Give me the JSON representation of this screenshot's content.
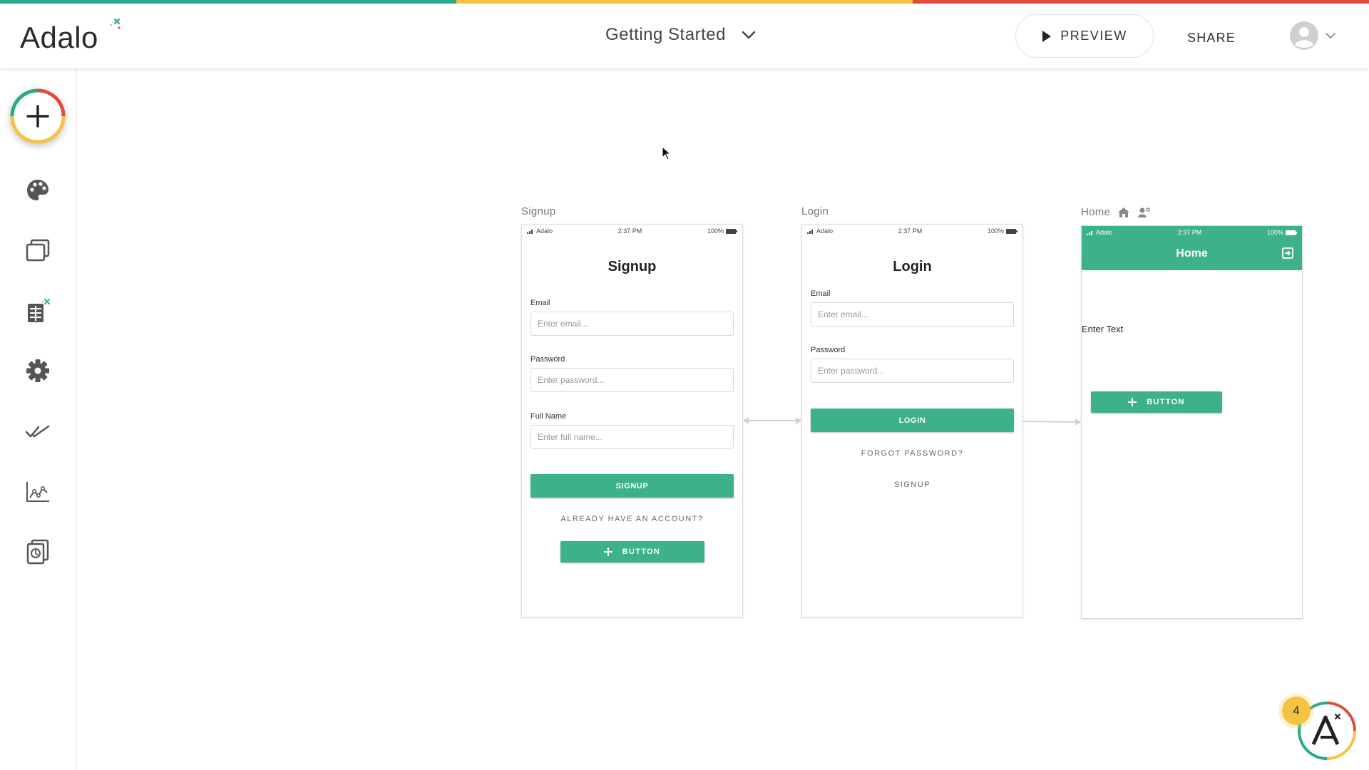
{
  "brand": {
    "name": "Adalo",
    "colors": {
      "green": "#3db08c",
      "yellow": "#f5c242",
      "red": "#e04b3c",
      "teal": "#27a98c"
    }
  },
  "header": {
    "app_name": "Getting Started",
    "preview_label": "PREVIEW",
    "share_label": "SHARE"
  },
  "sidebar": {
    "items": [
      {
        "icon": "plus-icon",
        "label": "Add"
      },
      {
        "icon": "palette-icon",
        "label": "Branding"
      },
      {
        "icon": "screens-icon",
        "label": "Screens"
      },
      {
        "icon": "database-icon",
        "label": "Database"
      },
      {
        "icon": "gear-icon",
        "label": "Settings"
      },
      {
        "icon": "publish-checkmark-icon",
        "label": "Publish"
      },
      {
        "icon": "analytics-icon",
        "label": "Analytics"
      },
      {
        "icon": "versions-icon",
        "label": "Versions"
      }
    ]
  },
  "screens": {
    "signup": {
      "label": "Signup",
      "status": {
        "carrier": "Adalo",
        "time": "2:37 PM",
        "battery": "100%"
      },
      "title": "Signup",
      "email_label": "Email",
      "email_placeholder": "Enter email...",
      "password_label": "Password",
      "password_placeholder": "Enter password...",
      "fullname_label": "Full Name",
      "fullname_placeholder": "Enter full name...",
      "submit_label": "SIGNUP",
      "link_label": "ALREADY HAVE AN ACCOUNT?",
      "button_label": "BUTTON"
    },
    "login": {
      "label": "Login",
      "status": {
        "carrier": "Adalo",
        "time": "2:37 PM",
        "battery": "100%"
      },
      "title": "Login",
      "email_label": "Email",
      "email_placeholder": "Enter email...",
      "password_label": "Password",
      "password_placeholder": "Enter password...",
      "submit_label": "LOGIN",
      "forgot_label": "FORGOT PASSWORD?",
      "signup_link_label": "SIGNUP"
    },
    "home": {
      "label": "Home",
      "status": {
        "carrier": "Adalo",
        "time": "2:37 PM",
        "battery": "100%"
      },
      "title": "Home",
      "text": "Enter Text",
      "button_label": "BUTTON"
    }
  },
  "help": {
    "badge_count": "4"
  }
}
